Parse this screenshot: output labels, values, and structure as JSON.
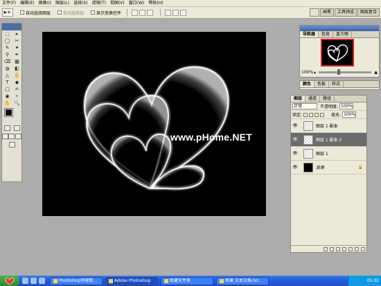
{
  "menu": [
    "文件(F)",
    "编辑(E)",
    "图像(I)",
    "图层(L)",
    "选择(S)",
    "滤镜(T)",
    "视图(V)",
    "窗口(W)",
    "帮助(H)"
  ],
  "options": {
    "tool_glyph": "▸+",
    "auto_select_group": "自动选择图层",
    "auto_select_layer": "自动选择组",
    "show_transform": "显示变换控件"
  },
  "wells": [
    "画笔",
    "工具预设",
    "图层复合"
  ],
  "toolbox": {
    "tools": [
      "⬚",
      "▸",
      "◯",
      "✂",
      "✎",
      "✦",
      "⚲",
      "✒",
      "⌫",
      "▦",
      "◍",
      "◧",
      "△",
      "✋",
      "T",
      "◆",
      "□",
      "✍",
      "◉",
      "⚬",
      "✋",
      "🔍"
    ]
  },
  "canvas": {
    "watermark": "www.pHome.NET"
  },
  "navigator": {
    "tabs": [
      "导航器",
      "信息",
      "直方图"
    ],
    "zoom": "100%"
  },
  "color_panel": {
    "tabs": [
      "颜色",
      "色板",
      "样式"
    ]
  },
  "layers": {
    "tabs": [
      "图层",
      "通道",
      "路径"
    ],
    "blend_mode": "正常",
    "opacity_label": "不透明度:",
    "opacity": "100%",
    "lock_label": "锁定:",
    "fill_label": "填充:",
    "fill": "100%",
    "items": [
      {
        "name": "图层 1 副本",
        "selected": false,
        "thumb": "transparent"
      },
      {
        "name": "图层 1 副本 2",
        "selected": true,
        "thumb": "transparent"
      },
      {
        "name": "图层 1",
        "selected": false,
        "thumb": "transparent"
      },
      {
        "name": "背景",
        "selected": false,
        "thumb": "black",
        "locked": true
      }
    ]
  },
  "taskbar": {
    "tasks": [
      "Photoshop快速制...",
      "Adobe Photoshop",
      "新建文件夹",
      "新建 文本文档.txt..."
    ],
    "clock": "05:32"
  }
}
